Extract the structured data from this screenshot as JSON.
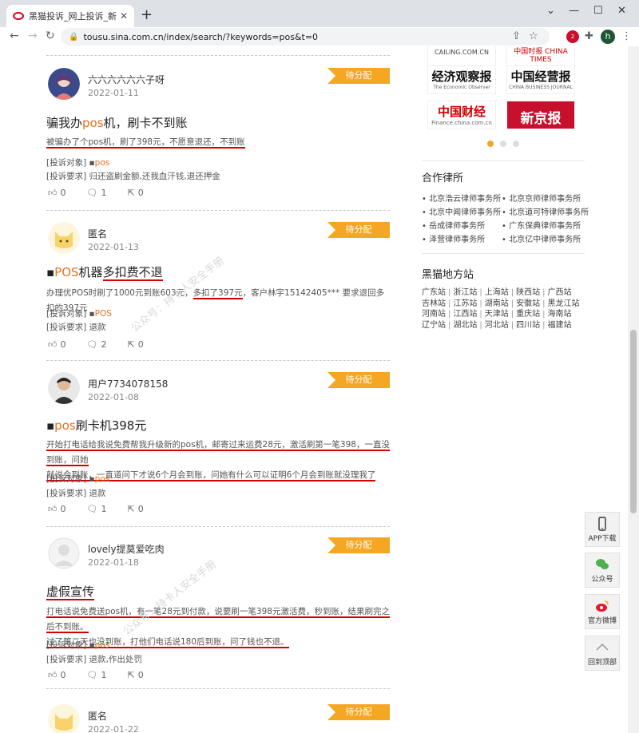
{
  "browser": {
    "tab_title": "黑猫投诉_网上投诉_新浪旗下消费",
    "url": "tousu.sina.com.cn/index/search/?keywords=pos&t=0",
    "profile_initial": "h",
    "ext_badge": "2"
  },
  "posts": [
    {
      "user": "六六六六六六子呀",
      "date": "2022-01-11",
      "status": "待分配",
      "title_pre": "骗我办",
      "title_hl": "pos",
      "title_post": "机，刷卡不到账",
      "desc": "被骗办了个pos机，刷了398元，不愿意退还，不到账",
      "target_label": "[投诉对象]",
      "target": "pos",
      "req_label": "[投诉要求]",
      "req": "归还盗刷金额,还我血汗钱,退还押金",
      "likes": "0",
      "comments": "1",
      "shares": "0"
    },
    {
      "user": "匿名",
      "date": "2022-01-13",
      "status": "待分配",
      "title_hl": "POS",
      "title_mid": "机器",
      "title_ul": "多扣费不退",
      "desc_a": "办理优POS时刷了1000元到账603元，",
      "desc_ul": "多扣了397元",
      "desc_b": "，客户林宇15142405*** 要求退回多扣的397元",
      "target_label": "[投诉对象]",
      "target": "POS",
      "req_label": "[投诉要求]",
      "req": "退款",
      "likes": "0",
      "comments": "2",
      "shares": "0"
    },
    {
      "user": "用户7734078158",
      "date": "2022-01-08",
      "status": "待分配",
      "title_hl": "pos",
      "title_post": "刷卡机398元",
      "desc_line1": "开始打电话给我说免费帮我升级新的pos机，邮寄过来运费28元，激活刷第一笔398，一直没到账，问她",
      "desc_line2": "就说会到账，一直道问下才说6个月会到账，问她有什么可以证明6个月会到账就没理我了",
      "target_label": "[投诉对象]",
      "target": "pos",
      "req_label": "[投诉要求]",
      "req": "退款",
      "likes": "0",
      "comments": "1",
      "shares": "0"
    },
    {
      "user": "lovely提莫爱吃肉",
      "date": "2022-01-18",
      "status": "待分配",
      "title": "虚假宣传",
      "desc_line1": "打电话说免费送pos机，有一笔28元到付款，说要刷一笔398元激活费，秒到账，结果刷完之后不到账。",
      "desc_line2": "过了第二天也没到账，打他们电话说180后到账，问了钱也不退。",
      "target_label": "[投诉对象]",
      "target": "pos",
      "req_label": "[投诉要求]",
      "req": "退款,作出处罚",
      "likes": "0",
      "comments": "1",
      "shares": "0"
    },
    {
      "user": "匿名",
      "date": "2022-01-22",
      "status": "待分配"
    }
  ],
  "sidebar": {
    "media_logos": [
      "CAILING.COM.CN",
      "中国时报 CHINA TIMES",
      "经济观察报",
      "The Economic Observer",
      "中国经营报",
      "CHINA BUSINESS JOURNAL",
      "中国财经",
      "Finance.china.com.cn",
      "新京报"
    ],
    "law_title": "合作律所",
    "law_firms": [
      "北京浩云律师事务所",
      "北京京师律师事务所",
      "北京中闻律师事务所",
      "北京道可特律师事务所",
      "岳成律师事务所",
      "广东保典律师事务所",
      "泽营律师事务所",
      "北京亿中律师事务所"
    ],
    "station_title": "黑猫地方站",
    "station_rows": [
      [
        "广东站",
        "浙江站",
        "上海站",
        "陕西站",
        "广西站"
      ],
      [
        "吉林站",
        "江苏站",
        "湖南站",
        "安徽站",
        "黑龙江站"
      ],
      [
        "河南站",
        "江西站",
        "天津站",
        "重庆站",
        "海南站"
      ],
      [
        "辽宁站",
        "湖北站",
        "河北站",
        "四川站",
        "福建站"
      ]
    ]
  },
  "floating": {
    "app": "APP下载",
    "wechat": "公众号",
    "weibo": "官方微博",
    "top": "回到顶部"
  },
  "watermark": "公众号：持卡人安全手册",
  "colors": {
    "accent": "#f5a623",
    "highlight": "#e86f1f",
    "underline": "#d40000"
  }
}
